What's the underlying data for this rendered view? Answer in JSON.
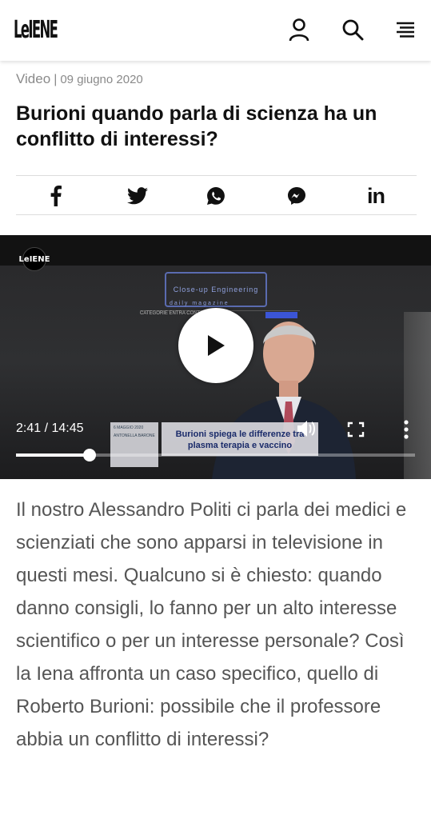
{
  "header": {
    "logo": "LeIENE",
    "icons": [
      "user-icon",
      "search-icon",
      "menu-icon"
    ]
  },
  "meta": {
    "category": "Video",
    "separator": "|",
    "date": "09 giugno 2020"
  },
  "article": {
    "title": "Burioni quando parla di scienza ha un conflitto di interessi?",
    "body": "Il nostro Alessandro Politi ci parla dei medici e scienziati che sono apparsi in televisione in questi mesi. Qualcuno si è chiesto: quando danno consigli, lo fanno per un alto interesse scientifico o per un interesse personale? Così la Iena affronta un caso specifico, quello di Roberto Burioni: possibile che il professore abbia un conflitto di interessi?"
  },
  "share": {
    "icons": [
      "facebook-icon",
      "twitter-icon",
      "whatsapp-icon",
      "messenger-icon",
      "linkedin-icon"
    ],
    "linkedin_label": "in"
  },
  "video": {
    "channel_logo": "LeIENE",
    "site_title": "Close-up Engineering",
    "site_subtitle": "daily magazine",
    "site_menu": "CATEGORIE  ENTRA  CONTATTI",
    "side_card_date": "6 MAGGIO 2020",
    "side_card_author": "ANTONELLA BARONE",
    "caption": "Burioni spiega le differenze tra plasma terapia e vaccino",
    "current_time": "2:41",
    "duration": "14:45",
    "time_display": "2:41 / 14:45",
    "progress": 0.185
  },
  "colors": {
    "meta_gray": "#8a8a8a",
    "body_gray": "#555555",
    "video_bg": "#1b1b1b",
    "caption_text": "#1a2b6a"
  }
}
